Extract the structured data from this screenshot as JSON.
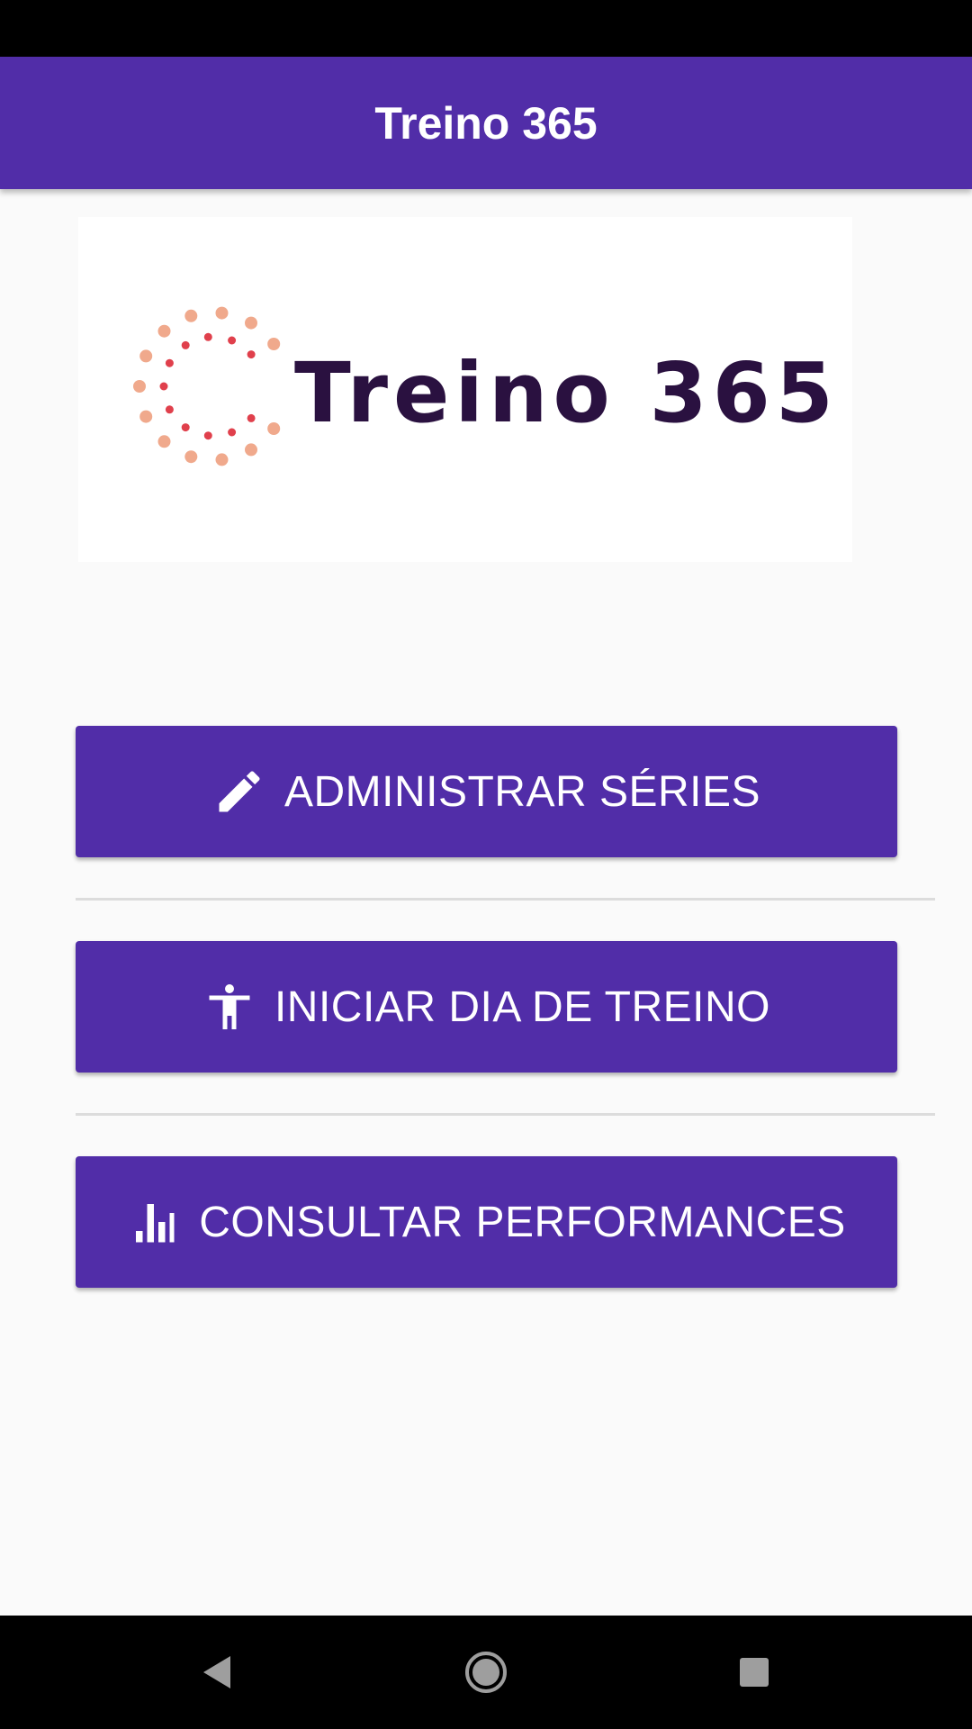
{
  "app_bar": {
    "title": "Treino 365"
  },
  "logo": {
    "text": "Treino 365",
    "dot_colors": [
      "#f0a98c",
      "#e0404c"
    ]
  },
  "menu": {
    "buttons": [
      {
        "label": "ADMINISTRAR SÉRIES",
        "icon": "pencil-icon"
      },
      {
        "label": "INICIAR DIA DE TREINO",
        "icon": "accessibility-icon"
      },
      {
        "label": "CONSULTAR PERFORMANCES",
        "icon": "bar-chart-icon"
      }
    ]
  },
  "nav_bar": {
    "back_icon": "back-triangle-icon",
    "home_icon": "home-circle-icon",
    "recents_icon": "recents-square-icon"
  },
  "colors": {
    "primary": "#512da8",
    "background": "#fafafa",
    "on_primary": "#ffffff"
  }
}
